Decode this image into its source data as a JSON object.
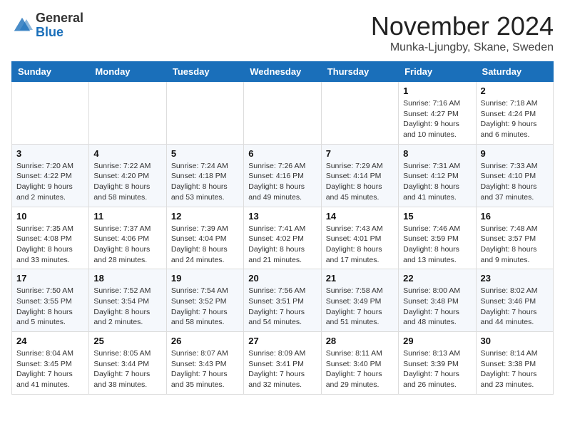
{
  "logo": {
    "general": "General",
    "blue": "Blue"
  },
  "header": {
    "title": "November 2024",
    "location": "Munka-Ljungby, Skane, Sweden"
  },
  "weekdays": [
    "Sunday",
    "Monday",
    "Tuesday",
    "Wednesday",
    "Thursday",
    "Friday",
    "Saturday"
  ],
  "weeks": [
    [
      {
        "day": "",
        "info": ""
      },
      {
        "day": "",
        "info": ""
      },
      {
        "day": "",
        "info": ""
      },
      {
        "day": "",
        "info": ""
      },
      {
        "day": "",
        "info": ""
      },
      {
        "day": "1",
        "info": "Sunrise: 7:16 AM\nSunset: 4:27 PM\nDaylight: 9 hours and 10 minutes."
      },
      {
        "day": "2",
        "info": "Sunrise: 7:18 AM\nSunset: 4:24 PM\nDaylight: 9 hours and 6 minutes."
      }
    ],
    [
      {
        "day": "3",
        "info": "Sunrise: 7:20 AM\nSunset: 4:22 PM\nDaylight: 9 hours and 2 minutes."
      },
      {
        "day": "4",
        "info": "Sunrise: 7:22 AM\nSunset: 4:20 PM\nDaylight: 8 hours and 58 minutes."
      },
      {
        "day": "5",
        "info": "Sunrise: 7:24 AM\nSunset: 4:18 PM\nDaylight: 8 hours and 53 minutes."
      },
      {
        "day": "6",
        "info": "Sunrise: 7:26 AM\nSunset: 4:16 PM\nDaylight: 8 hours and 49 minutes."
      },
      {
        "day": "7",
        "info": "Sunrise: 7:29 AM\nSunset: 4:14 PM\nDaylight: 8 hours and 45 minutes."
      },
      {
        "day": "8",
        "info": "Sunrise: 7:31 AM\nSunset: 4:12 PM\nDaylight: 8 hours and 41 minutes."
      },
      {
        "day": "9",
        "info": "Sunrise: 7:33 AM\nSunset: 4:10 PM\nDaylight: 8 hours and 37 minutes."
      }
    ],
    [
      {
        "day": "10",
        "info": "Sunrise: 7:35 AM\nSunset: 4:08 PM\nDaylight: 8 hours and 33 minutes."
      },
      {
        "day": "11",
        "info": "Sunrise: 7:37 AM\nSunset: 4:06 PM\nDaylight: 8 hours and 28 minutes."
      },
      {
        "day": "12",
        "info": "Sunrise: 7:39 AM\nSunset: 4:04 PM\nDaylight: 8 hours and 24 minutes."
      },
      {
        "day": "13",
        "info": "Sunrise: 7:41 AM\nSunset: 4:02 PM\nDaylight: 8 hours and 21 minutes."
      },
      {
        "day": "14",
        "info": "Sunrise: 7:43 AM\nSunset: 4:01 PM\nDaylight: 8 hours and 17 minutes."
      },
      {
        "day": "15",
        "info": "Sunrise: 7:46 AM\nSunset: 3:59 PM\nDaylight: 8 hours and 13 minutes."
      },
      {
        "day": "16",
        "info": "Sunrise: 7:48 AM\nSunset: 3:57 PM\nDaylight: 8 hours and 9 minutes."
      }
    ],
    [
      {
        "day": "17",
        "info": "Sunrise: 7:50 AM\nSunset: 3:55 PM\nDaylight: 8 hours and 5 minutes."
      },
      {
        "day": "18",
        "info": "Sunrise: 7:52 AM\nSunset: 3:54 PM\nDaylight: 8 hours and 2 minutes."
      },
      {
        "day": "19",
        "info": "Sunrise: 7:54 AM\nSunset: 3:52 PM\nDaylight: 7 hours and 58 minutes."
      },
      {
        "day": "20",
        "info": "Sunrise: 7:56 AM\nSunset: 3:51 PM\nDaylight: 7 hours and 54 minutes."
      },
      {
        "day": "21",
        "info": "Sunrise: 7:58 AM\nSunset: 3:49 PM\nDaylight: 7 hours and 51 minutes."
      },
      {
        "day": "22",
        "info": "Sunrise: 8:00 AM\nSunset: 3:48 PM\nDaylight: 7 hours and 48 minutes."
      },
      {
        "day": "23",
        "info": "Sunrise: 8:02 AM\nSunset: 3:46 PM\nDaylight: 7 hours and 44 minutes."
      }
    ],
    [
      {
        "day": "24",
        "info": "Sunrise: 8:04 AM\nSunset: 3:45 PM\nDaylight: 7 hours and 41 minutes."
      },
      {
        "day": "25",
        "info": "Sunrise: 8:05 AM\nSunset: 3:44 PM\nDaylight: 7 hours and 38 minutes."
      },
      {
        "day": "26",
        "info": "Sunrise: 8:07 AM\nSunset: 3:43 PM\nDaylight: 7 hours and 35 minutes."
      },
      {
        "day": "27",
        "info": "Sunrise: 8:09 AM\nSunset: 3:41 PM\nDaylight: 7 hours and 32 minutes."
      },
      {
        "day": "28",
        "info": "Sunrise: 8:11 AM\nSunset: 3:40 PM\nDaylight: 7 hours and 29 minutes."
      },
      {
        "day": "29",
        "info": "Sunrise: 8:13 AM\nSunset: 3:39 PM\nDaylight: 7 hours and 26 minutes."
      },
      {
        "day": "30",
        "info": "Sunrise: 8:14 AM\nSunset: 3:38 PM\nDaylight: 7 hours and 23 minutes."
      }
    ]
  ]
}
